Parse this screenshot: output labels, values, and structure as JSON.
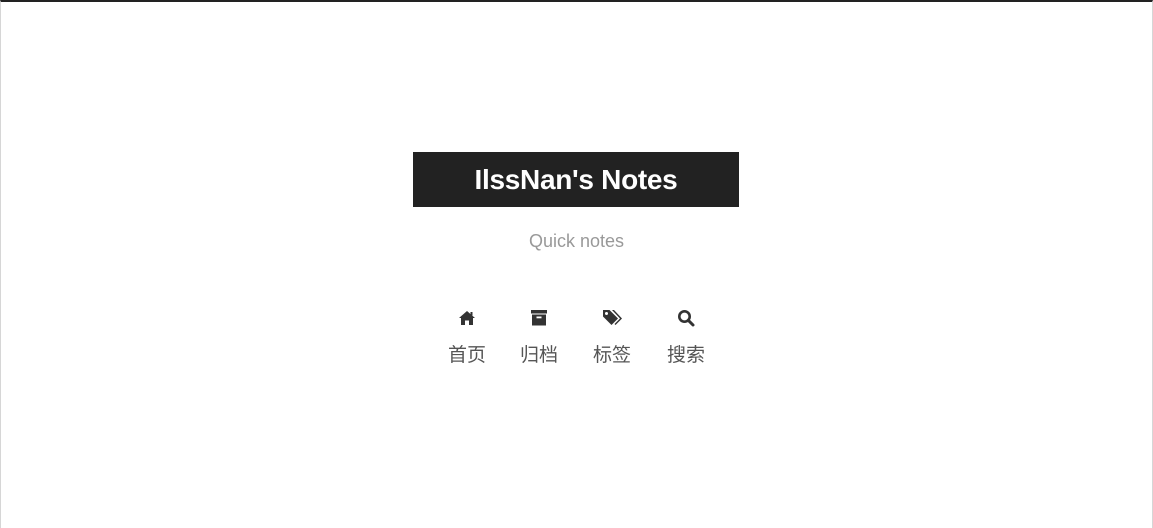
{
  "site": {
    "title": "IlssNan's Notes",
    "subtitle": "Quick notes"
  },
  "menu": {
    "items": [
      {
        "label": "首页",
        "icon": "home-icon"
      },
      {
        "label": "归档",
        "icon": "archive-icon"
      },
      {
        "label": "标签",
        "icon": "tags-icon"
      },
      {
        "label": "搜索",
        "icon": "search-icon"
      }
    ]
  },
  "colors": {
    "brand_bg": "#222222",
    "brand_text": "#ffffff",
    "subtitle": "#999999",
    "menu_text": "#555555",
    "top_border": "#222222"
  }
}
